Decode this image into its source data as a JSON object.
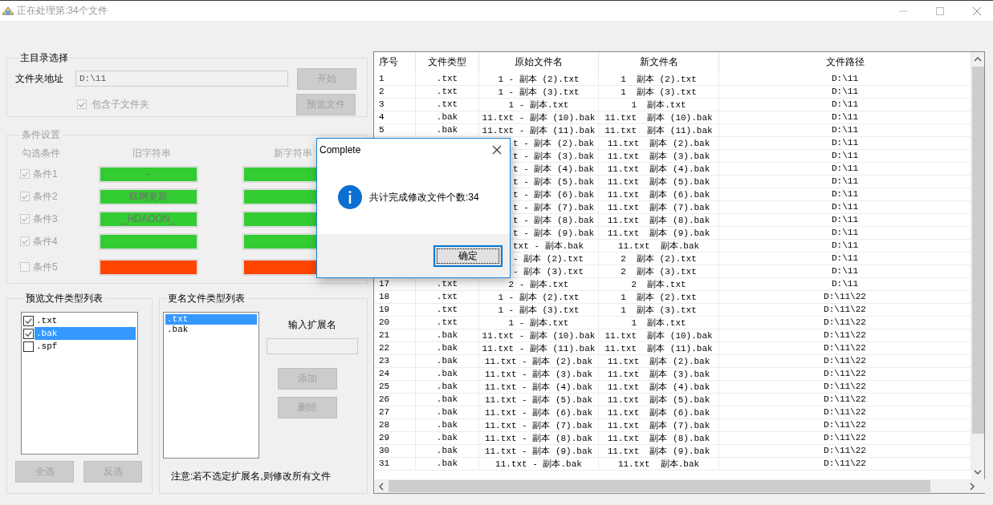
{
  "window": {
    "title": "正在处理第:34个文件"
  },
  "main_dir": {
    "legend": "主目录选择",
    "folder_label": "文件夹地址",
    "folder_value": "D:\\11",
    "include_sub": {
      "label": "包含子文件夹",
      "checked": true,
      "disabled": true
    },
    "buttons": [
      {
        "label": "开始",
        "disabled": true
      },
      {
        "label": "预览文件",
        "disabled": true
      }
    ]
  },
  "conditions": {
    "legend": "条件设置",
    "disabled": true,
    "headers": [
      "勾选条件",
      "旧字符串",
      "新字符串"
    ],
    "rows": [
      {
        "label": "条件1",
        "checked": true,
        "old": "-"
      },
      {
        "label": "条件2",
        "checked": true,
        "old": "联网更新"
      },
      {
        "label": "条件3",
        "checked": true,
        "old": "_HDAOON_"
      },
      {
        "label": "条件4",
        "checked": true
      },
      {
        "label": "条件5",
        "checked": false
      }
    ]
  },
  "preview_types": {
    "legend": "预览文件类型列表",
    "items": [
      {
        "label": ".txt",
        "checked": true,
        "selected": false
      },
      {
        "label": ".bak",
        "checked": true,
        "selected": true
      },
      {
        "label": ".spf",
        "checked": false,
        "selected": false
      }
    ],
    "buttons": [
      {
        "label": "全选",
        "disabled": true
      },
      {
        "label": "反选",
        "disabled": true
      }
    ]
  },
  "rename_types": {
    "legend": "更名文件类型列表",
    "items": [
      {
        "label": ".txt",
        "selected": true
      },
      {
        "label": ".bak",
        "selected": false
      }
    ],
    "ext_label": "输入扩展名",
    "buttons": [
      {
        "label": "添加",
        "disabled": true
      },
      {
        "label": "删除",
        "disabled": true
      }
    ],
    "note": "注意:若不选定扩展名,则修改所有文件"
  },
  "table": {
    "columns": [
      "序号",
      "文件类型",
      "原始文件名",
      "新文件名",
      "文件路径"
    ],
    "rows": [
      {
        "seq": "1",
        "type": ".txt",
        "original": "1 - 副本 (2).txt",
        "new": "1  副本 (2).txt",
        "path": "D:\\11"
      },
      {
        "seq": "2",
        "type": ".txt",
        "original": "1 - 副本 (3).txt",
        "new": "1  副本 (3).txt",
        "path": "D:\\11"
      },
      {
        "seq": "3",
        "type": ".txt",
        "original": "1 - 副本.txt",
        "new": "1  副本.txt",
        "path": "D:\\11"
      },
      {
        "seq": "4",
        "type": ".bak",
        "original": "11.txt - 副本 (10).bak",
        "new": "11.txt  副本 (10).bak",
        "path": "D:\\11"
      },
      {
        "seq": "5",
        "type": ".bak",
        "original": "11.txt - 副本 (11).bak",
        "new": "11.txt  副本 (11).bak",
        "path": "D:\\11"
      },
      {
        "original": "t - 副本 (2).bak",
        "new": "11.txt  副本 (2).bak",
        "path": "D:\\11"
      },
      {
        "original": "t - 副本 (3).bak",
        "new": "11.txt  副本 (3).bak",
        "path": "D:\\11"
      },
      {
        "original": "t - 副本 (4).bak",
        "new": "11.txt  副本 (4).bak",
        "path": "D:\\11"
      },
      {
        "original": "t - 副本 (5).bak",
        "new": "11.txt  副本 (5).bak",
        "path": "D:\\11"
      },
      {
        "original": "t - 副本 (6).bak",
        "new": "11.txt  副本 (6).bak",
        "path": "D:\\11"
      },
      {
        "original": "t - 副本 (7).bak",
        "new": "11.txt  副本 (7).bak",
        "path": "D:\\11"
      },
      {
        "original": "t - 副本 (8).bak",
        "new": "11.txt  副本 (8).bak",
        "path": "D:\\11"
      },
      {
        "original": "t - 副本 (9).bak",
        "new": "11.txt  副本 (9).bak",
        "path": "D:\\11"
      },
      {
        "original": "txt - 副本.bak",
        "new": "11.txt  副本.bak",
        "path": "D:\\11"
      },
      {
        "original": "- 副本 (2).txt",
        "new": "2  副本 (2).txt",
        "path": "D:\\11"
      },
      {
        "original": "- 副本 (3).txt",
        "new": "2  副本 (3).txt",
        "path": "D:\\11"
      },
      {
        "seq": "17",
        "type": ".txt",
        "original": "2 - 副本.txt",
        "new": "2  副本.txt",
        "path": "D:\\11"
      },
      {
        "seq": "18",
        "type": ".txt",
        "original": "1 - 副本 (2).txt",
        "new": "1  副本 (2).txt",
        "path": "D:\\11\\22"
      },
      {
        "seq": "19",
        "type": ".txt",
        "original": "1 - 副本 (3).txt",
        "new": "1  副本 (3).txt",
        "path": "D:\\11\\22"
      },
      {
        "seq": "20",
        "type": ".txt",
        "original": "1 - 副本.txt",
        "new": "1  副本.txt",
        "path": "D:\\11\\22"
      },
      {
        "seq": "21",
        "type": ".bak",
        "original": "11.txt - 副本 (10).bak",
        "new": "11.txt  副本 (10).bak",
        "path": "D:\\11\\22"
      },
      {
        "seq": "22",
        "type": ".bak",
        "original": "11.txt - 副本 (11).bak",
        "new": "11.txt  副本 (11).bak",
        "path": "D:\\11\\22"
      },
      {
        "seq": "23",
        "type": ".bak",
        "original": "11.txt - 副本 (2).bak",
        "new": "11.txt  副本 (2).bak",
        "path": "D:\\11\\22"
      },
      {
        "seq": "24",
        "type": ".bak",
        "original": "11.txt - 副本 (3).bak",
        "new": "11.txt  副本 (3).bak",
        "path": "D:\\11\\22"
      },
      {
        "seq": "25",
        "type": ".bak",
        "original": "11.txt - 副本 (4).bak",
        "new": "11.txt  副本 (4).bak",
        "path": "D:\\11\\22"
      },
      {
        "seq": "26",
        "type": ".bak",
        "original": "11.txt - 副本 (5).bak",
        "new": "11.txt  副本 (5).bak",
        "path": "D:\\11\\22"
      },
      {
        "seq": "27",
        "type": ".bak",
        "original": "11.txt - 副本 (6).bak",
        "new": "11.txt  副本 (6).bak",
        "path": "D:\\11\\22"
      },
      {
        "seq": "28",
        "type": ".bak",
        "original": "11.txt - 副本 (7).bak",
        "new": "11.txt  副本 (7).bak",
        "path": "D:\\11\\22"
      },
      {
        "seq": "29",
        "type": ".bak",
        "original": "11.txt - 副本 (8).bak",
        "new": "11.txt  副本 (8).bak",
        "path": "D:\\11\\22"
      },
      {
        "seq": "30",
        "type": ".bak",
        "original": "11.txt - 副本 (9).bak",
        "new": "11.txt  副本 (9).bak",
        "path": "D:\\11\\22"
      },
      {
        "seq": "31",
        "type": ".bak",
        "original": "11.txt - 副本.bak",
        "new": "11.txt  副本.bak",
        "path": "D:\\11\\22"
      }
    ]
  },
  "dialog": {
    "title": "Complete",
    "message": "共计完成修改文件个数:34",
    "button": "确定"
  }
}
